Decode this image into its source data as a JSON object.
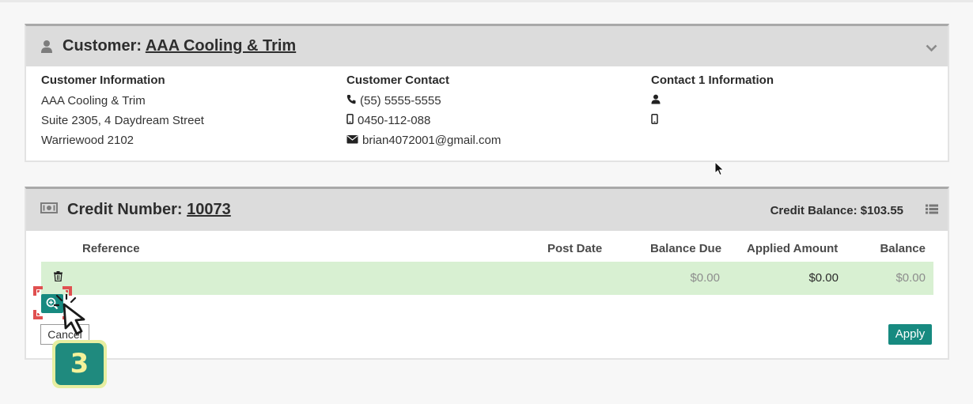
{
  "customer": {
    "label": "Customer:",
    "name": "AAA Cooling & Trim",
    "info": {
      "heading": "Customer Information",
      "line1": "AAA Cooling & Trim",
      "line2": "Suite 2305, 4 Daydream Street",
      "line3": "Warriewood 2102"
    },
    "contact": {
      "heading": "Customer Contact",
      "phone": "(55) 5555-5555",
      "mobile": "0450-112-088",
      "email": "brian4072001@gmail.com"
    },
    "contact1": {
      "heading": "Contact 1 Information"
    }
  },
  "credit": {
    "label": "Credit Number:",
    "number": "10073",
    "balance": "Credit Balance: $103.55",
    "columns": {
      "reference": "Reference",
      "post_date": "Post Date",
      "balance_due": "Balance Due",
      "applied_amount": "Applied Amount",
      "balance": "Balance"
    },
    "row": {
      "balance_due": "$0.00",
      "applied_amount": "$0.00",
      "balance": "$0.00"
    },
    "cancel_label": "Cancel",
    "apply_label": "Apply"
  },
  "tutorial": {
    "step": "3"
  },
  "colors": {
    "accent": "#178a80",
    "row_highlight": "#d8f0d2",
    "header_bg": "#dcdcdc",
    "step_badge": "#e6eea0",
    "highlight_red": "#e05050"
  },
  "icons": [
    "person-icon",
    "chevron-down-icon",
    "phone-icon",
    "mobile-icon",
    "envelope-icon",
    "money-icon",
    "list-icon",
    "trash-icon",
    "zoom-in-icon",
    "cursor-icon"
  ]
}
